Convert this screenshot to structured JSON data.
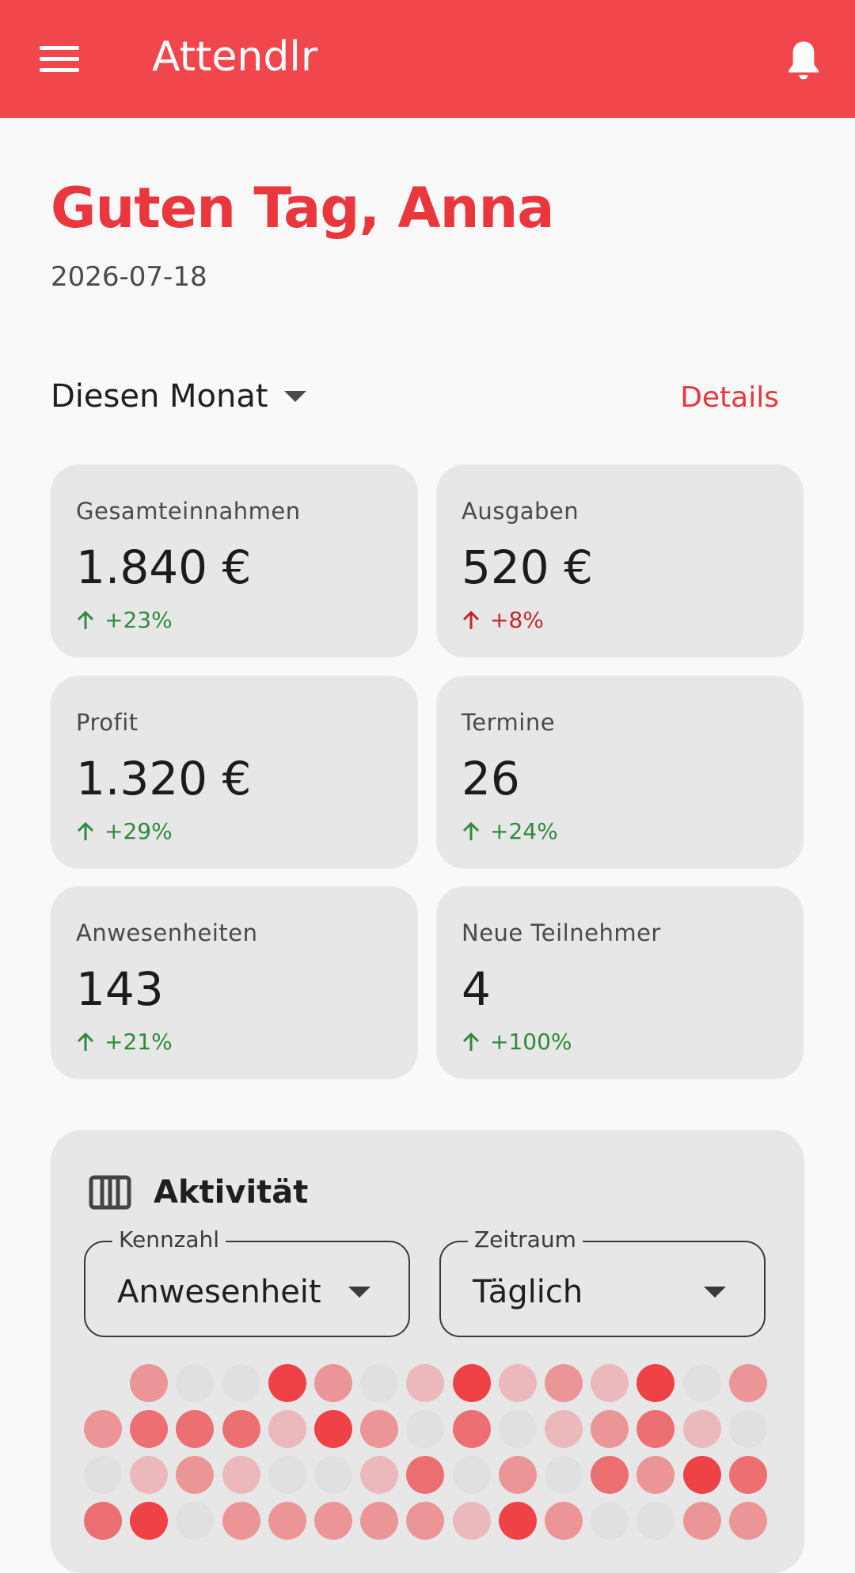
{
  "app": {
    "title": "Attendlr"
  },
  "greeting": "Guten Tag, Anna",
  "date": "2026-07-18",
  "period": {
    "selected": "Diesen Monat",
    "details_label": "Details"
  },
  "stats": [
    {
      "label": "Gesamteinnahmen",
      "value": "1.840 €",
      "change": "+23%",
      "trend": "up-positive"
    },
    {
      "label": "Ausgaben",
      "value": "520 €",
      "change": "+8%",
      "trend": "up-negative"
    },
    {
      "label": "Profit",
      "value": "1.320 €",
      "change": "+29%",
      "trend": "up-positive"
    },
    {
      "label": "Termine",
      "value": "26",
      "change": "+24%",
      "trend": "up-positive"
    },
    {
      "label": "Anwesenheiten",
      "value": "143",
      "change": "+21%",
      "trend": "up-positive"
    },
    {
      "label": "Neue Teilnehmer",
      "value": "4",
      "change": "+100%",
      "trend": "up-positive"
    }
  ],
  "activity": {
    "title": "Aktivität",
    "metric": {
      "label": "Kennzahl",
      "value": "Anwesenheit"
    },
    "range": {
      "label": "Zeitraum",
      "value": "Täglich"
    },
    "heatmap_levels": [
      [
        null,
        2,
        0,
        0,
        4,
        2,
        0,
        1,
        4,
        1,
        2,
        1,
        4,
        0,
        2
      ],
      [
        2,
        3,
        3,
        3,
        1,
        4,
        2,
        0,
        3,
        0,
        1,
        2,
        3,
        1,
        0
      ],
      [
        0,
        1,
        2,
        1,
        0,
        0,
        1,
        3,
        0,
        2,
        0,
        3,
        2,
        4,
        3
      ],
      [
        3,
        4,
        0,
        2,
        2,
        2,
        2,
        2,
        1,
        4,
        2,
        0,
        0,
        2,
        2
      ]
    ]
  },
  "colors": {
    "accent": "#f1464b",
    "positive": "#2e8b3a",
    "negative": "#c8242b",
    "heat_levels": [
      "#e0e0e0",
      "#ebb9bb",
      "#eb9597",
      "#ec6f72",
      "#ee4246"
    ]
  }
}
